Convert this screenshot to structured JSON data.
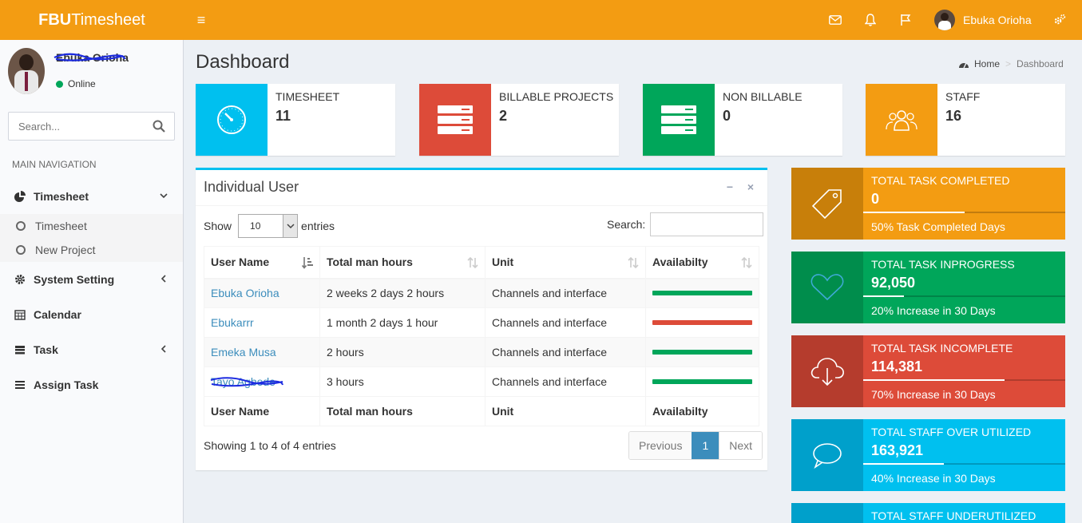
{
  "header": {
    "logo_bold": "FBU",
    "logo_light": "Timesheet",
    "user_name": "Ebuka Orioha"
  },
  "sidebar": {
    "user_name": "Ebuka Orioha",
    "status": "Online",
    "search_placeholder": "Search...",
    "nav_header": "MAIN NAVIGATION",
    "items": [
      {
        "label": "Timesheet",
        "icon": "pie-chart-icon"
      },
      {
        "label": "System Setting",
        "icon": "gear-icon"
      },
      {
        "label": "Calendar",
        "icon": "calendar-icon"
      },
      {
        "label": "Task",
        "icon": "table-icon"
      },
      {
        "label": "Assign Task",
        "icon": "list-icon"
      }
    ],
    "sub_items": [
      {
        "label": "Timesheet"
      },
      {
        "label": "New Project"
      }
    ]
  },
  "page": {
    "title": "Dashboard",
    "breadcrumb": {
      "home": "Home",
      "current": "Dashboard"
    }
  },
  "info_boxes": [
    {
      "label": "TIMESHEET",
      "value": "11",
      "color": "#00c0ef",
      "icon": "clock-icon"
    },
    {
      "label": "BILLABLE PROJECTS",
      "value": "2",
      "color": "#dd4b39",
      "icon": "server-icon"
    },
    {
      "label": "NON BILLABLE",
      "value": "0",
      "color": "#00a65a",
      "icon": "server-icon"
    },
    {
      "label": "STAFF",
      "value": "16",
      "color": "#f39c12",
      "icon": "users-icon"
    }
  ],
  "user_box": {
    "title": "Individual User",
    "show_label": "Show",
    "entries_label": "entries",
    "length_value": "10",
    "search_label": "Search:",
    "columns": [
      "User Name",
      "Total man hours",
      "Unit",
      "Availabilty"
    ],
    "rows": [
      {
        "name": "Ebuka Orioha",
        "hours": "2 weeks 2 days 2 hours",
        "unit": "Channels and interface",
        "status": "green"
      },
      {
        "name": "Ebukarrr",
        "hours": "1 month 2 days 1 hour",
        "unit": "Channels and interface",
        "status": "red"
      },
      {
        "name": "Emeka Musa",
        "hours": "2 hours",
        "unit": "Channels and interface",
        "status": "green"
      },
      {
        "name": "Tayo Agbede",
        "hours": "3 hours",
        "unit": "Channels and interface",
        "status": "green"
      }
    ],
    "info": "Showing 1 to 4 of 4 entries",
    "pager": {
      "prev": "Previous",
      "page": "1",
      "next": "Next"
    }
  },
  "stats": [
    {
      "title": "TOTAL TASK COMPLETED",
      "value": "0",
      "desc": "50% Task Completed Days",
      "progress": 0.5,
      "color": "#f39c12",
      "dark": "#c87f0a",
      "icon": "tag-icon"
    },
    {
      "title": "TOTAL TASK INPROGRESS",
      "value": "92,050",
      "desc": "20% Increase in 30 Days",
      "progress": 0.2,
      "color": "#00a65a",
      "dark": "#008d4c",
      "icon": "heart-icon"
    },
    {
      "title": "TOTAL TASK INCOMPLETE",
      "value": "114,381",
      "desc": "70% Increase in 30 Days",
      "progress": 0.7,
      "color": "#dd4b39",
      "dark": "#b53c2d",
      "icon": "cloud-download-icon"
    },
    {
      "title": "TOTAL STAFF OVER UTILIZED",
      "value": "163,921",
      "desc": "40% Increase in 30 Days",
      "progress": 0.4,
      "color": "#00c0ef",
      "dark": "#00a0cb",
      "icon": "chat-icon"
    },
    {
      "title": "TOTAL STAFF UNDERUTILIZED",
      "value": "",
      "desc": "",
      "progress": 0,
      "color": "#00c0ef",
      "dark": "#00a0cb",
      "icon": "chat-icon"
    }
  ]
}
